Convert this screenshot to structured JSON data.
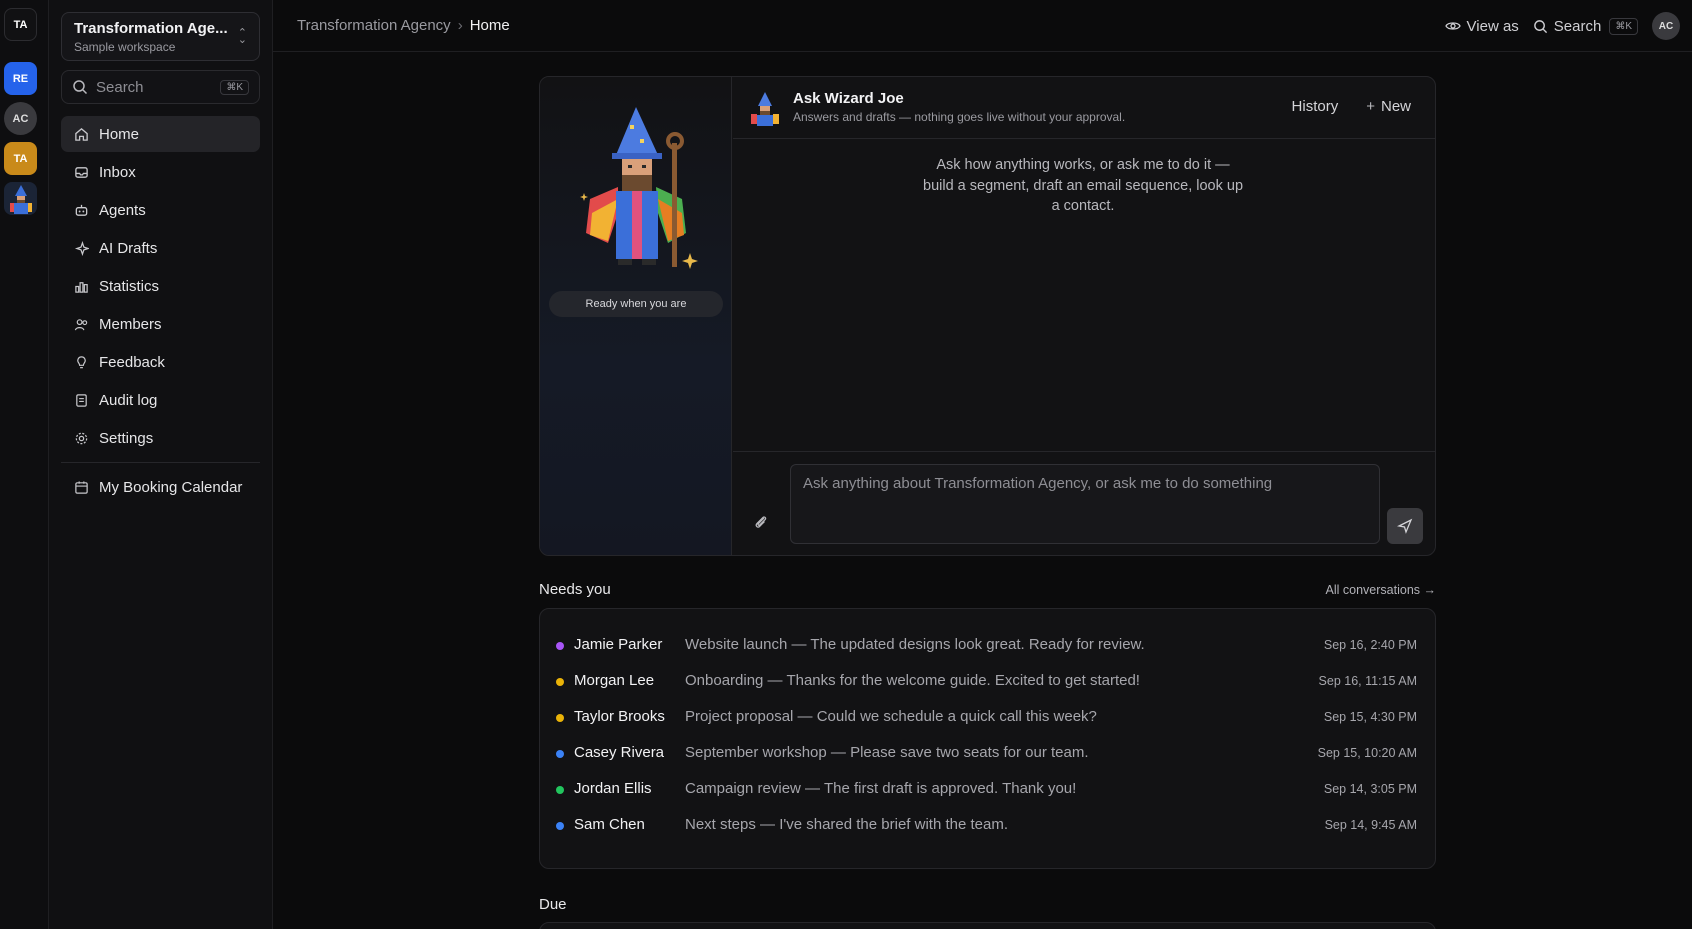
{
  "rail": {
    "workspaces": [
      "TA",
      "RE",
      "AC",
      "TA"
    ]
  },
  "sidebar": {
    "workspace_name": "Transformation Age...",
    "workspace_sub": "Sample workspace",
    "search_placeholder": "Search",
    "search_shortcut": "⌘K",
    "items": [
      {
        "label": "Home",
        "icon": "home-icon"
      },
      {
        "label": "Inbox",
        "icon": "inbox-icon"
      },
      {
        "label": "Agents",
        "icon": "robot-icon"
      },
      {
        "label": "AI Drafts",
        "icon": "sparkle-icon"
      },
      {
        "label": "Statistics",
        "icon": "chart-icon"
      },
      {
        "label": "Members",
        "icon": "users-icon"
      },
      {
        "label": "Feedback",
        "icon": "lightbulb-icon"
      },
      {
        "label": "Audit log",
        "icon": "log-icon"
      },
      {
        "label": "Settings",
        "icon": "gear-icon"
      },
      {
        "label": "My Booking Calendar",
        "icon": "calendar-icon"
      }
    ]
  },
  "topbar": {
    "breadcrumb_parent": "Transformation Agency",
    "breadcrumb_current": "Home",
    "view_as": "View as",
    "search": "Search",
    "search_shortcut": "⌘K",
    "avatar": "AC"
  },
  "assistant": {
    "ready": "Ready when you are",
    "title": "Ask Wizard Joe",
    "subtitle": "Answers and drafts — nothing goes live without your approval.",
    "history": "History",
    "new": "New",
    "hint": "Ask how anything works, or ask me to do it — build a segment, draft an email sequence, look up a contact.",
    "placeholder": "Ask anything about Transformation Agency, or ask me to do something"
  },
  "needs_you": {
    "title": "Needs you",
    "all_link": "All conversations →",
    "rows": [
      {
        "name": "Jamie Parker",
        "message": "Website launch — The updated designs look great. Ready for review.",
        "time": "Sep 16, 2:40 PM",
        "color": "#a855f7"
      },
      {
        "name": "Morgan Lee",
        "message": "Onboarding — Thanks for the welcome guide. Excited to get started!",
        "time": "Sep 16, 11:15 AM",
        "color": "#eab308"
      },
      {
        "name": "Taylor Brooks",
        "message": "Project proposal — Could we schedule a quick call this week?",
        "time": "Sep 15, 4:30 PM",
        "color": "#eab308"
      },
      {
        "name": "Casey Rivera",
        "message": "September workshop — Please save two seats for our team.",
        "time": "Sep 15, 10:20 AM",
        "color": "#3b82f6"
      },
      {
        "name": "Jordan Ellis",
        "message": "Campaign review — The first draft is approved. Thank you!",
        "time": "Sep 14, 3:05 PM",
        "color": "#22c55e"
      },
      {
        "name": "Sam Chen",
        "message": "Next steps — I've shared the brief with the team.",
        "time": "Sep 14, 9:45 AM",
        "color": "#3b82f6"
      }
    ]
  },
  "due": {
    "title": "Due"
  }
}
